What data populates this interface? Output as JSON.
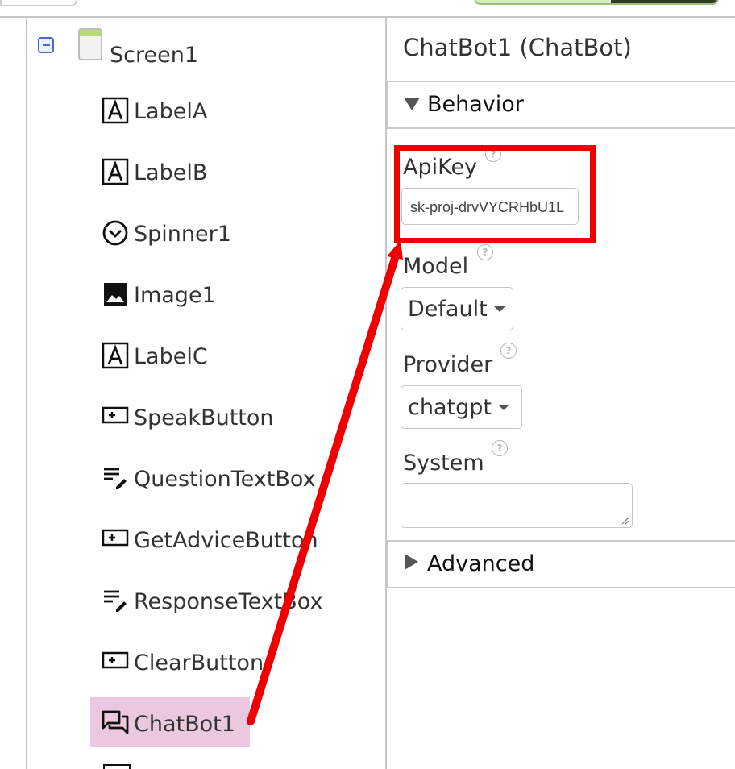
{
  "component_tree": {
    "root": {
      "label": "Screen1"
    },
    "items": [
      {
        "label": "LabelA",
        "icon": "label-icon"
      },
      {
        "label": "LabelB",
        "icon": "label-icon"
      },
      {
        "label": "Spinner1",
        "icon": "spinner-icon"
      },
      {
        "label": "Image1",
        "icon": "image-icon"
      },
      {
        "label": "LabelC",
        "icon": "label-icon"
      },
      {
        "label": "SpeakButton",
        "icon": "button-icon"
      },
      {
        "label": "QuestionTextBox",
        "icon": "textbox-icon"
      },
      {
        "label": "GetAdviceButton",
        "icon": "button-icon"
      },
      {
        "label": "ResponseTextBox",
        "icon": "textbox-icon"
      },
      {
        "label": "ClearButton",
        "icon": "button-icon"
      },
      {
        "label": "ChatBot1",
        "icon": "chatbot-icon",
        "selected": true
      }
    ]
  },
  "properties": {
    "title": "ChatBot1 (ChatBot)",
    "sections": {
      "behavior": "Behavior",
      "advanced": "Advanced"
    },
    "fields": {
      "apikey": {
        "label": "ApiKey",
        "value": "sk-proj-drvVYCRHbU1L"
      },
      "model": {
        "label": "Model",
        "value": "Default"
      },
      "provider": {
        "label": "Provider",
        "value": "chatgpt"
      },
      "system": {
        "label": "System",
        "value": ""
      }
    },
    "help_symbol": "?"
  },
  "annotation": {
    "highlight_color": "#ee0000"
  },
  "colors": {
    "selected_background": "#ecc8e0",
    "collapse_icon": "#4a6ad8",
    "screen_icon_bar": "#b6d97a"
  }
}
